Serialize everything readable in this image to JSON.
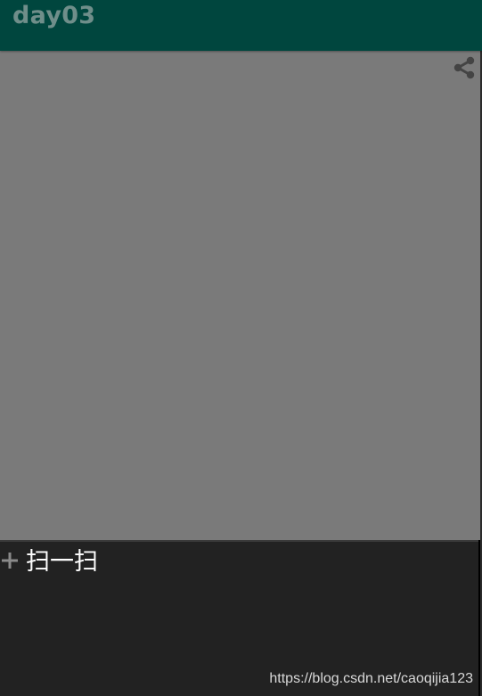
{
  "app_bar": {
    "title": "day03"
  },
  "content": {
    "share_icon": "share-icon"
  },
  "bottom_panel": {
    "add_icon": "plus-icon",
    "scan_label": "扫一扫"
  },
  "watermark": {
    "text": "https://blog.csdn.net/caoqijia123"
  },
  "colors": {
    "app_bar": "#00463e",
    "title": "#6f8e8a",
    "content_bg": "#7a7a7a",
    "bottom_panel_bg": "#222222",
    "icon": "#444444",
    "plus": "#8a8a8a"
  }
}
